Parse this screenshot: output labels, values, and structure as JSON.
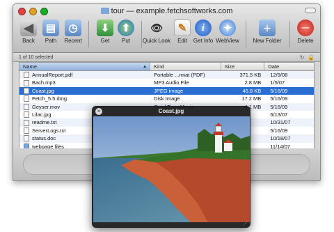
{
  "window": {
    "title": "tour — example.fetchsoftworks.com",
    "light_colors": [
      "#e0443e",
      "#dea123",
      "#1aab29"
    ]
  },
  "toolbar": {
    "back": "Back",
    "path": "Path",
    "recent": "Recent",
    "get": "Get",
    "put": "Put",
    "quick_look": "Quick Look",
    "edit": "Edit",
    "get_info": "Get Info",
    "webview": "WebView",
    "new_folder": "New Folder",
    "delete": "Delete"
  },
  "status": {
    "selection": "1 of 10 selected"
  },
  "columns": {
    "name": "Name",
    "kind": "Kind",
    "size": "Size",
    "date": "Date"
  },
  "files": [
    {
      "name": "AnnualReport.pdf",
      "kind": "Portable ...rmat (PDF)",
      "size": "371.5 KB",
      "date": "12/9/08",
      "icon": "document-icon"
    },
    {
      "name": "Bach.mp3",
      "kind": "MP3 Audio File",
      "size": "2.8 MB",
      "date": "1/5/07",
      "icon": "audio-file-icon"
    },
    {
      "name": "Coast.jpg",
      "kind": "JPEG image",
      "size": "45.8 KB",
      "date": "5/16/09",
      "icon": "image-file-icon",
      "selected": true
    },
    {
      "name": "Fetch_5.5.dmg",
      "kind": "Disk Image",
      "size": "17.2 MB",
      "date": "5/16/09",
      "icon": "disk-image-icon"
    },
    {
      "name": "Geyser.mov",
      "kind": "QuickTime Movie",
      "size": "4.1 MB",
      "date": "5/16/09",
      "icon": "movie-file-icon"
    },
    {
      "name": "Lilac.jpg",
      "kind": "",
      "size": "",
      "date": "6/13/07",
      "icon": "image-file-icon"
    },
    {
      "name": "readme.txt",
      "kind": "",
      "size": "",
      "date": "10/31/07",
      "icon": "text-file-icon"
    },
    {
      "name": "ServerLogs.txt",
      "kind": "",
      "size": "",
      "date": "5/16/09",
      "icon": "text-file-icon"
    },
    {
      "name": "status.doc",
      "kind": "",
      "size": "",
      "date": "10/18/07",
      "icon": "document-icon"
    },
    {
      "name": "webpage files",
      "kind": "",
      "size": "",
      "date": "11/14/07",
      "icon": "folder-icon"
    }
  ],
  "quicklook": {
    "title": "Coast.jpg"
  }
}
